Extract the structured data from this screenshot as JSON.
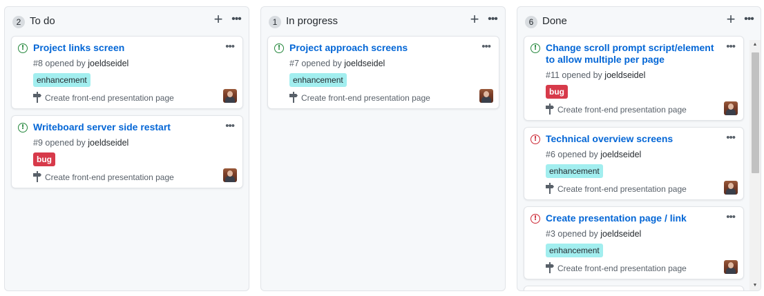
{
  "columns": [
    {
      "count": "2",
      "title": "To do",
      "cards": [
        {
          "state": "open",
          "title": "Project links screen",
          "number": "#8",
          "opened_by": "opened by",
          "author": "joeldseidel",
          "label": "enhancement",
          "label_type": "enhancement",
          "milestone": "Create front-end presentation page"
        },
        {
          "state": "open",
          "title": "Writeboard server side restart",
          "number": "#9",
          "opened_by": "opened by",
          "author": "joeldseidel",
          "label": "bug",
          "label_type": "bug",
          "milestone": "Create front-end presentation page"
        }
      ]
    },
    {
      "count": "1",
      "title": "In progress",
      "cards": [
        {
          "state": "open",
          "title": "Project approach screens",
          "number": "#7",
          "opened_by": "opened by",
          "author": "joeldseidel",
          "label": "enhancement",
          "label_type": "enhancement",
          "milestone": "Create front-end presentation page"
        }
      ]
    },
    {
      "count": "6",
      "title": "Done",
      "cards": [
        {
          "state": "open",
          "title": "Change scroll prompt script/element to allow multiple per page",
          "number": "#11",
          "opened_by": "opened by",
          "author": "joeldseidel",
          "label": "bug",
          "label_type": "bug",
          "milestone": "Create front-end presentation page"
        },
        {
          "state": "closed",
          "title": "Technical overview screens",
          "number": "#6",
          "opened_by": "opened by",
          "author": "joeldseidel",
          "label": "enhancement",
          "label_type": "enhancement",
          "milestone": "Create front-end presentation page"
        },
        {
          "state": "closed",
          "title": "Create presentation page / link",
          "number": "#3",
          "opened_by": "opened by",
          "author": "joeldseidel",
          "label": "enhancement",
          "label_type": "enhancement",
          "milestone": "Create front-end presentation page"
        }
      ]
    }
  ],
  "icons": {
    "add": "plus-icon",
    "menu": "kebab-menu-icon",
    "open_issue": "issue-opened-icon",
    "closed_issue": "issue-closed-icon",
    "milestone": "milestone-icon"
  },
  "colors": {
    "link": "#0366d6",
    "open": "#22863a",
    "closed": "#cb2431",
    "enhancement": "#a2eeef",
    "bug": "#d73a4a"
  }
}
